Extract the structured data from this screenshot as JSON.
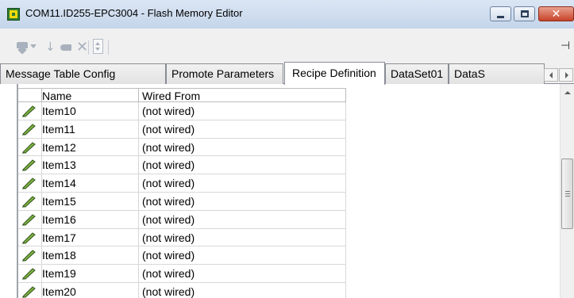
{
  "window": {
    "title": "COM11.ID255-EPC3004 - Flash Memory Editor",
    "icon": "app-icon",
    "controls": {
      "minimize": "minimize-icon",
      "maximize": "maximize-icon",
      "close": "close-icon",
      "close_glyph": "✕"
    }
  },
  "toolbar": {
    "pin_glyph": "⊣",
    "down_glyph": "↓",
    "x_glyph": "✕"
  },
  "tabs": [
    {
      "label": "Message Table Config",
      "active": false
    },
    {
      "label": "Promote Parameters",
      "active": false
    },
    {
      "label": "Recipe Definition",
      "active": true
    },
    {
      "label": "DataSet01",
      "active": false
    },
    {
      "label": "DataS",
      "active": false
    }
  ],
  "grid": {
    "columns": [
      "Name",
      "Wired From"
    ],
    "rows": [
      {
        "name": "Item10",
        "wired": "(not wired)"
      },
      {
        "name": "Item11",
        "wired": "(not wired)"
      },
      {
        "name": "Item12",
        "wired": "(not wired)"
      },
      {
        "name": "Item13",
        "wired": "(not wired)"
      },
      {
        "name": "Item14",
        "wired": "(not wired)"
      },
      {
        "name": "Item15",
        "wired": "(not wired)"
      },
      {
        "name": "Item16",
        "wired": "(not wired)"
      },
      {
        "name": "Item17",
        "wired": "(not wired)"
      },
      {
        "name": "Item18",
        "wired": "(not wired)"
      },
      {
        "name": "Item19",
        "wired": "(not wired)"
      },
      {
        "name": "Item20",
        "wired": "(not wired)"
      }
    ]
  },
  "colors": {
    "pencil_green": "#7cb342",
    "pencil_dark": "#33521a"
  }
}
